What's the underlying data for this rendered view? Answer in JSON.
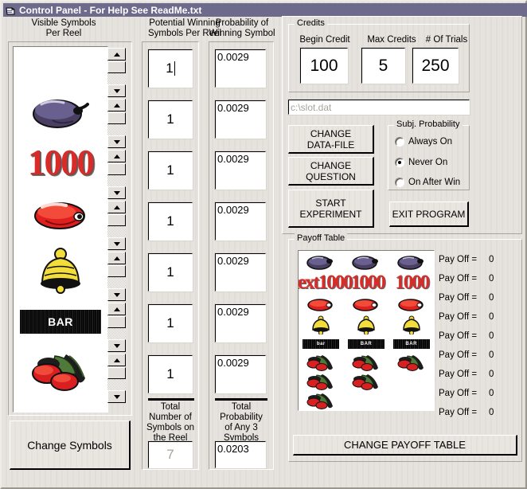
{
  "window": {
    "title": "Control Panel - For Help See ReadMe.txt",
    "icon": "window-document-icon",
    "titlebar_color": "#6e6a8c"
  },
  "columns": {
    "visible_symbols": {
      "header_line1": "Visible Symbols",
      "header_line2": "Per Reel",
      "change_symbols_label": "Change Symbols"
    },
    "potential_winning": {
      "header_line1": "Potential Winning",
      "header_line2": "Symbols Per Reel",
      "values": [
        "1",
        "1",
        "1",
        "1",
        "1",
        "1",
        "1"
      ],
      "total_label_lines": [
        "Total",
        "Number of",
        "Symbols on",
        "the Reel"
      ],
      "total_value": "7"
    },
    "probability": {
      "header_line1": "Probability of",
      "header_line2": "Winning Symbol",
      "values": [
        "0.0029",
        "0.0029",
        "0.0029",
        "0.0029",
        "0.0029",
        "0.0029",
        "0.0029"
      ],
      "total_label_lines": [
        "Total",
        "Probability",
        "of Any 3",
        "Symbols"
      ],
      "total_value": "0.0203"
    }
  },
  "reel_symbols": [
    {
      "name": "plum",
      "kind": "plum"
    },
    {
      "name": "1000",
      "kind": "text1000",
      "text": "1000"
    },
    {
      "name": "cherry-red",
      "kind": "redfruit"
    },
    {
      "name": "bell",
      "kind": "bell"
    },
    {
      "name": "bar",
      "kind": "bar",
      "text": "BAR"
    },
    {
      "name": "cherries",
      "kind": "cherries"
    }
  ],
  "credits": {
    "group_label": "Credits",
    "fields": [
      {
        "label": "Begin Credit",
        "value": "100"
      },
      {
        "label": "Max Credits",
        "value": "5"
      },
      {
        "label": "# Of Trials",
        "value": "250"
      }
    ]
  },
  "datafile": {
    "value": "c:\\slot.dat"
  },
  "actions": {
    "change_data_file": [
      "CHANGE",
      "DATA-FILE"
    ],
    "change_question": [
      "CHANGE",
      "QUESTION"
    ],
    "start_experiment": [
      "START",
      "EXPERIMENT"
    ],
    "exit_program": "EXIT PROGRAM",
    "change_payoff_table": "CHANGE PAYOFF TABLE"
  },
  "subj_probability": {
    "group_label": "Subj. Probability",
    "options": [
      {
        "label": "Always On",
        "selected": false
      },
      {
        "label": "Never On",
        "selected": true
      },
      {
        "label": "On After Win",
        "selected": false
      }
    ]
  },
  "payoff_table": {
    "group_label": "Payoff Table",
    "rows": [
      {
        "symbols": [
          "plum",
          "plum",
          "plum"
        ],
        "payoff_label": "Pay Off =",
        "payoff": "0"
      },
      {
        "symbols": [
          "text1000",
          "text1000",
          "text1000"
        ],
        "payoff_label": "Pay Off =",
        "payoff": "0"
      },
      {
        "symbols": [
          "redfruit",
          "redfruit",
          "redfruit"
        ],
        "payoff_label": "Pay Off =",
        "payoff": "0"
      },
      {
        "symbols": [
          "bell",
          "bell",
          "bell"
        ],
        "payoff_label": "Pay Off =",
        "payoff": "0"
      },
      {
        "symbols": [
          "bar",
          "bar",
          "bar"
        ],
        "payoff_label": "Pay Off =",
        "payoff": "0"
      },
      {
        "symbols": [
          "cherries",
          "cherries",
          "cherries"
        ],
        "payoff_label": "Pay Off =",
        "payoff": "0"
      },
      {
        "symbols": [
          "cherries",
          "cherries",
          ""
        ],
        "payoff_label": "Pay Off =",
        "payoff": "0"
      },
      {
        "symbols": [
          "cherries",
          "",
          ""
        ],
        "payoff_label": "Pay Off =",
        "payoff": "0"
      },
      {
        "symbols": [
          "",
          "",
          ""
        ],
        "payoff_label": "Pay Off =",
        "payoff": "0"
      }
    ]
  }
}
